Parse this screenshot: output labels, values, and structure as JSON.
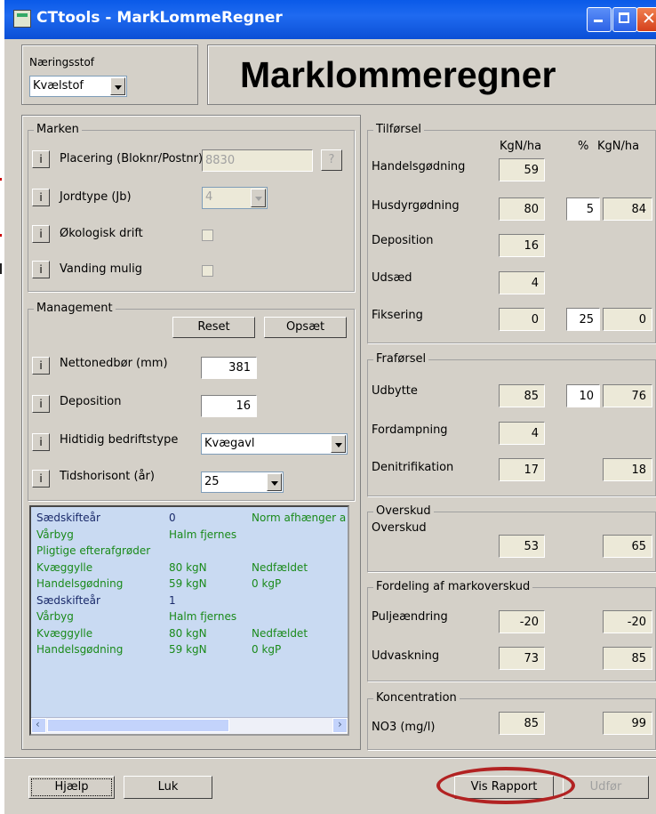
{
  "window": {
    "title": "CTtools - MarkLommeRegner"
  },
  "header": {
    "nutrient_label": "Næringsstof",
    "nutrient_value": "Kvælstof",
    "app_title": "Marklommeregner"
  },
  "marken": {
    "title": "Marken",
    "placement_label": "Placering (Bloknr/Postnr)",
    "placement_value": "8830",
    "help_label": "?",
    "soil_label": "Jordtype  (Jb)",
    "soil_value": "4",
    "organic_label": "Økologisk drift",
    "irrigation_label": "Vanding mulig"
  },
  "management": {
    "title": "Management",
    "reset_label": "Reset",
    "setup_label": "Opsæt",
    "precip_label": "Nettonedbør (mm)",
    "precip_value": "381",
    "deposition_label": "Deposition",
    "deposition_value": "16",
    "farmtype_label": "Hidtidig bedriftstype",
    "farmtype_value": "Kvægavl",
    "horizon_label": "Tidshorisont (år)",
    "horizon_value": "25"
  },
  "rotation_list": [
    [
      "Sædskifteår",
      "0",
      "Norm afhænger a"
    ],
    [
      "Vårbyg",
      "Halm fjernes",
      ""
    ],
    [
      "Pligtige efterafgrøder",
      "",
      ""
    ],
    [
      "Kvæggylle",
      "80 kgN",
      "Nedfældet"
    ],
    [
      "Handelsgødning",
      "59 kgN",
      "0 kgP"
    ],
    [
      "Sædskifteår",
      "1",
      ""
    ],
    [
      "Vårbyg",
      "Halm fjernes",
      ""
    ],
    [
      "Kvæggylle",
      "80 kgN",
      "Nedfældet"
    ],
    [
      "Handelsgødning",
      "59 kgN",
      "0 kgP"
    ]
  ],
  "tilforsel": {
    "title": "Tilførsel",
    "col1": "KgN/ha",
    "col2": "%",
    "col3": "KgN/ha",
    "rows": [
      {
        "label": "Handelsgødning",
        "v1": "59"
      },
      {
        "label": "Husdyrgødning",
        "v1": "80",
        "pct": "5",
        "v2": "84"
      },
      {
        "label": "Deposition",
        "v1": "16"
      },
      {
        "label": "Udsæd",
        "v1": "4"
      },
      {
        "label": "Fiksering",
        "v1": "0",
        "pct": "25",
        "v2": "0"
      }
    ]
  },
  "fraforsel": {
    "title": "Fraførsel",
    "rows": [
      {
        "label": "Udbytte",
        "v1": "85",
        "pct": "10",
        "v2": "76"
      },
      {
        "label": "Fordampning",
        "v1": "4"
      },
      {
        "label": "Denitrifikation",
        "v1": "17",
        "v2": "18"
      }
    ]
  },
  "overskud": {
    "title": "Overskud",
    "label": "Overskud",
    "v1": "53",
    "v2": "65"
  },
  "fordeling": {
    "title": "Fordeling af markoverskud",
    "pulje_label": "Puljeændring",
    "pulje_v1": "-20",
    "pulje_v2": "-20",
    "udv_label": "Udvaskning",
    "udv_v1": "73",
    "udv_v2": "85"
  },
  "koncentration": {
    "title": "Koncentration",
    "label": "NO3 (mg/l)",
    "v1": "85",
    "v2": "99"
  },
  "footer": {
    "help": "Hjælp",
    "close": "Luk",
    "report": "Vis Rapport",
    "execute": "Udfør"
  }
}
